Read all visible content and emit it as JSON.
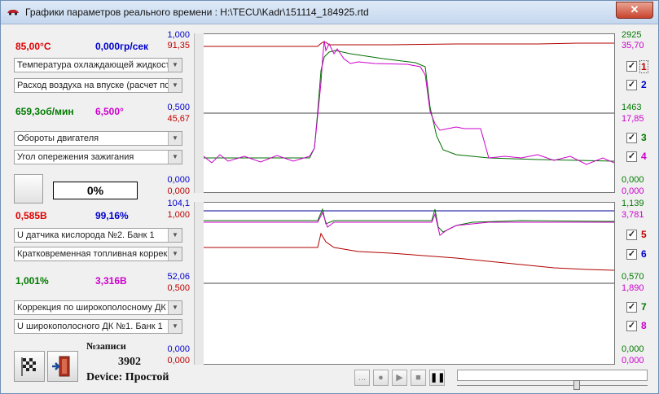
{
  "window": {
    "title": "Графики параметров реального времени : H:\\TECU\\Kadr\\151114_184925.rtd",
    "close_label": "✕"
  },
  "groups": [
    {
      "value_left": "85,00°C",
      "value_right": "0,000гр/сек",
      "color_left": "#e00000",
      "color_right": "#0000cc",
      "selects": [
        "Температура охлаждающей жидкости",
        "Расход воздуха на впуске (расчет по"
      ]
    },
    {
      "value_left": "659,3об/мин",
      "value_right": "6,500°",
      "color_left": "#007a00",
      "color_right": "#cc00cc",
      "selects": [
        "Обороты двигателя",
        "Угол опережения зажигания"
      ]
    },
    {
      "value_left": "0,585В",
      "value_right": "99,16%",
      "color_left": "#e00000",
      "color_right": "#0000cc",
      "selects": [
        "U датчика кислорода №2. Банк 1",
        "Кратковременная топливная коррекция"
      ]
    },
    {
      "value_left": "1,001%",
      "value_right": "3,316В",
      "color_left": "#007a00",
      "color_right": "#cc00cc",
      "selects": [
        "Коррекция по широкополосному ДК",
        "U широкополосного ДК №1. Банк 1"
      ]
    }
  ],
  "percent_box": "0%",
  "record": {
    "label": "№записи",
    "number": "3902",
    "device": "Device: Простой"
  },
  "scales": {
    "left": [
      {
        "text": "1,000",
        "color": "#0000cc"
      },
      {
        "text": "91,35",
        "color": "#c00000"
      },
      {
        "text": "0,500",
        "color": "#0000cc"
      },
      {
        "text": "45,67",
        "color": "#c00000"
      },
      {
        "text": "0,000",
        "color": "#0000cc"
      },
      {
        "text": "0,000",
        "color": "#c00000"
      },
      {
        "text": "104,1",
        "color": "#0000cc"
      },
      {
        "text": "1,000",
        "color": "#c00000"
      },
      {
        "text": "52,06",
        "color": "#0000cc"
      },
      {
        "text": "0,500",
        "color": "#c00000"
      },
      {
        "text": "0,000",
        "color": "#0000cc"
      },
      {
        "text": "0,000",
        "color": "#c00000"
      }
    ],
    "right": [
      {
        "text": "2925",
        "color": "#007a00"
      },
      {
        "text": "35,70",
        "color": "#cc00cc"
      },
      {
        "text": "1463",
        "color": "#007a00"
      },
      {
        "text": "17,85",
        "color": "#cc00cc"
      },
      {
        "text": "0,000",
        "color": "#007a00"
      },
      {
        "text": "0,000",
        "color": "#cc00cc"
      },
      {
        "text": "1,139",
        "color": "#007a00"
      },
      {
        "text": "3,781",
        "color": "#cc00cc"
      },
      {
        "text": "0,570",
        "color": "#007a00"
      },
      {
        "text": "1,890",
        "color": "#cc00cc"
      },
      {
        "text": "0,000",
        "color": "#007a00"
      },
      {
        "text": "0,000",
        "color": "#cc00cc"
      }
    ]
  },
  "channels": [
    {
      "num": "1",
      "checked": "✓",
      "color": "#c00000"
    },
    {
      "num": "2",
      "checked": "✓",
      "color": "#0000cc"
    },
    {
      "num": "3",
      "checked": "✓",
      "color": "#007a00"
    },
    {
      "num": "4",
      "checked": "✓",
      "color": "#cc00cc"
    },
    {
      "num": "5",
      "checked": "✓",
      "color": "#c00000"
    },
    {
      "num": "6",
      "checked": "✓",
      "color": "#0000cc"
    },
    {
      "num": "7",
      "checked": "✓",
      "color": "#007a00"
    },
    {
      "num": "8",
      "checked": "✓",
      "color": "#cc00cc"
    }
  ],
  "player": {
    "more_label": "...",
    "record_icon": "●",
    "play_icon": "▶",
    "stop_icon": "■",
    "pause_icon": "❚❚"
  },
  "icons": {
    "flag": "checkered-flag-icon",
    "exit": "exit-door-icon"
  }
}
